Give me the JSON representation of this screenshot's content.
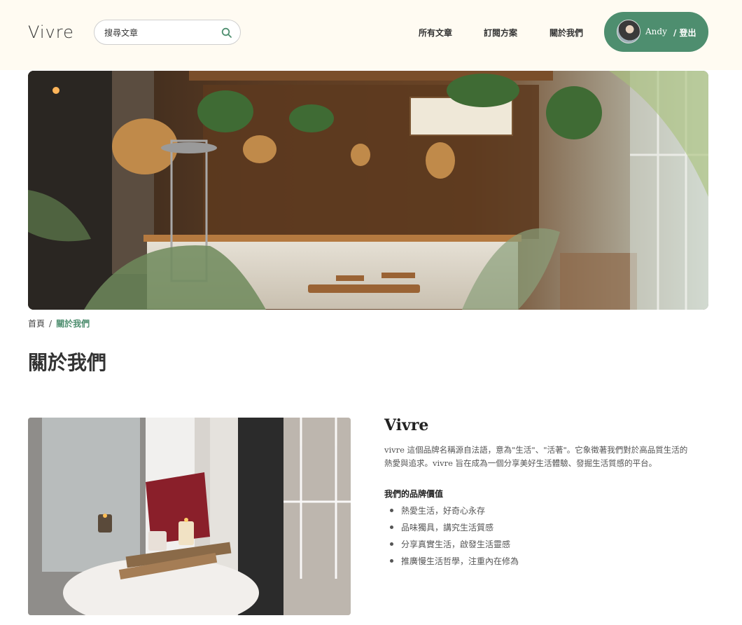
{
  "header": {
    "logo": "Vivre",
    "search": {
      "placeholder": "搜尋文章",
      "icon": "search-icon"
    },
    "nav": [
      "所有文章",
      "訂閱方案",
      "關於我們"
    ],
    "user": {
      "name": "Andy",
      "logout_label": "/ 登出"
    }
  },
  "colors": {
    "accent": "#4e8e6f",
    "header_bg": "#fffbf2"
  },
  "breadcrumb": {
    "home": "首頁",
    "separator": "/",
    "current": "關於我們"
  },
  "page_title": "關於我們",
  "brand": {
    "title": "Vivre",
    "description": "vivre 這個品牌名稱源自法語，意為\"生活\"、\"活著\"。它象徵著我們對於高品質生活的熱愛與追求。vivre 旨在成為一個分享美好生活體驗、發掘生活質感的平台。",
    "values_heading": "我們的品牌價值",
    "values": [
      "熱愛生活，好奇心永存",
      "品味獨具，講究生活質感",
      "分享真實生活，啟發生活靈感",
      "推廣慢生活哲學，注重內在修為"
    ]
  }
}
